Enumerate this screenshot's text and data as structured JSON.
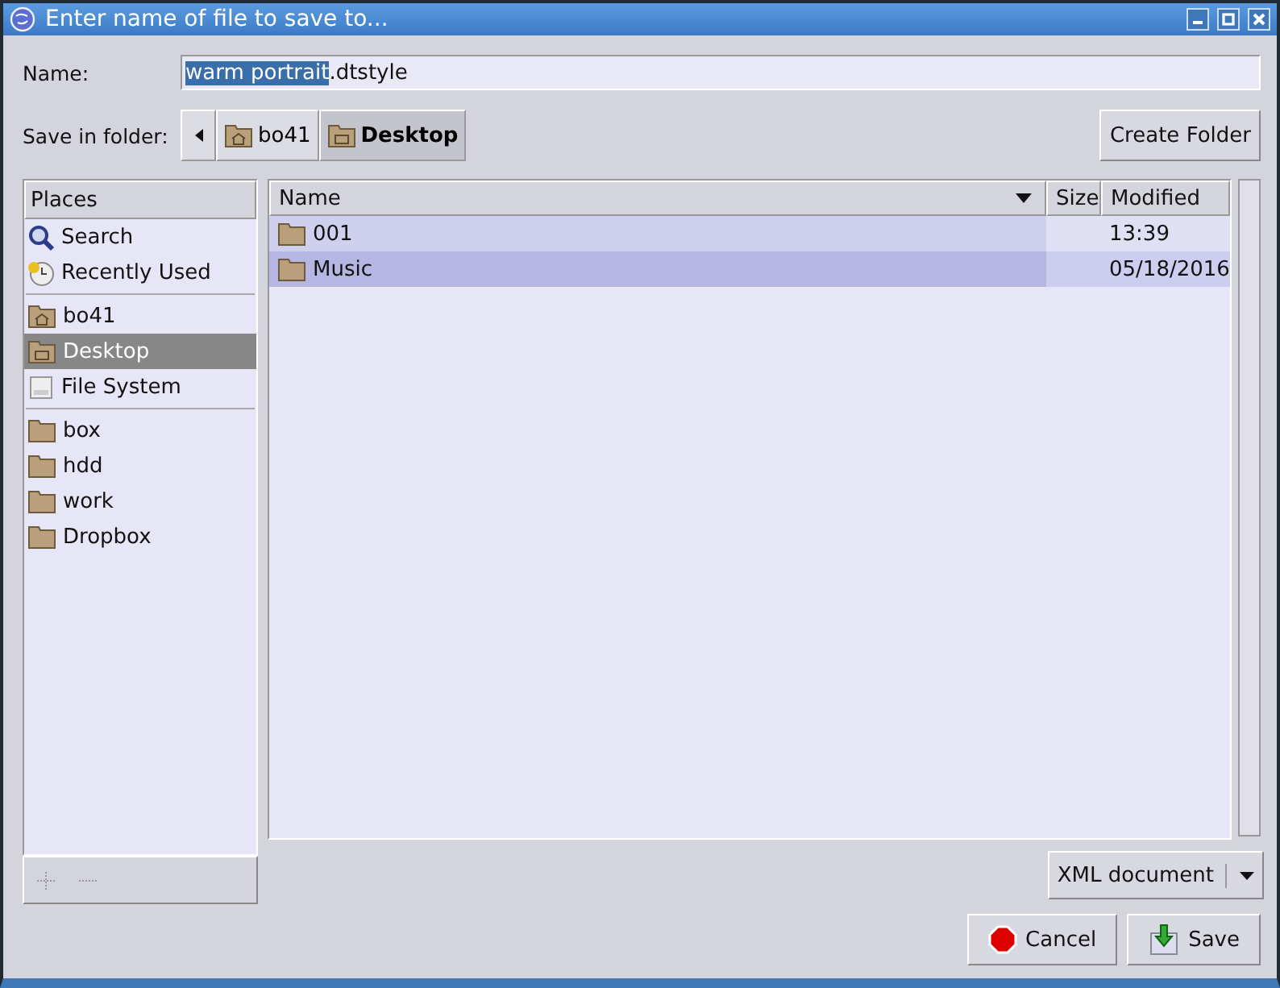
{
  "window": {
    "title": "Enter name of file to save to..."
  },
  "name_field": {
    "label": "Name:",
    "value_selected": "warm portrait",
    "value_rest": ".dtstyle"
  },
  "folder_bar": {
    "label": "Save in folder:",
    "path": [
      {
        "label": "bo41",
        "kind": "home",
        "selected": false
      },
      {
        "label": "Desktop",
        "kind": "desktop",
        "selected": true
      }
    ]
  },
  "create_folder_button": "Create Folder",
  "places": {
    "header": "Places",
    "groups": [
      [
        {
          "label": "Search",
          "kind": "search",
          "selected": false
        },
        {
          "label": "Recently Used",
          "kind": "recent",
          "selected": false
        }
      ],
      [
        {
          "label": "bo41",
          "kind": "home",
          "selected": false
        },
        {
          "label": "Desktop",
          "kind": "desktop",
          "selected": true
        },
        {
          "label": "File System",
          "kind": "drive",
          "selected": false
        }
      ],
      [
        {
          "label": "box",
          "kind": "folder",
          "selected": false
        },
        {
          "label": "hdd",
          "kind": "folder",
          "selected": false
        },
        {
          "label": "work",
          "kind": "folder",
          "selected": false
        },
        {
          "label": "Dropbox",
          "kind": "folder",
          "selected": false
        }
      ]
    ]
  },
  "files": {
    "columns": [
      "Name",
      "Size",
      "Modified"
    ],
    "rows": [
      {
        "name": "001",
        "size": "",
        "modified": "13:39"
      },
      {
        "name": "Music",
        "size": "",
        "modified": "05/18/2016"
      }
    ]
  },
  "filter": "XML document",
  "buttons": [
    {
      "label": "Cancel",
      "kind": "cancel"
    },
    {
      "label": "Save",
      "kind": "save"
    }
  ]
}
